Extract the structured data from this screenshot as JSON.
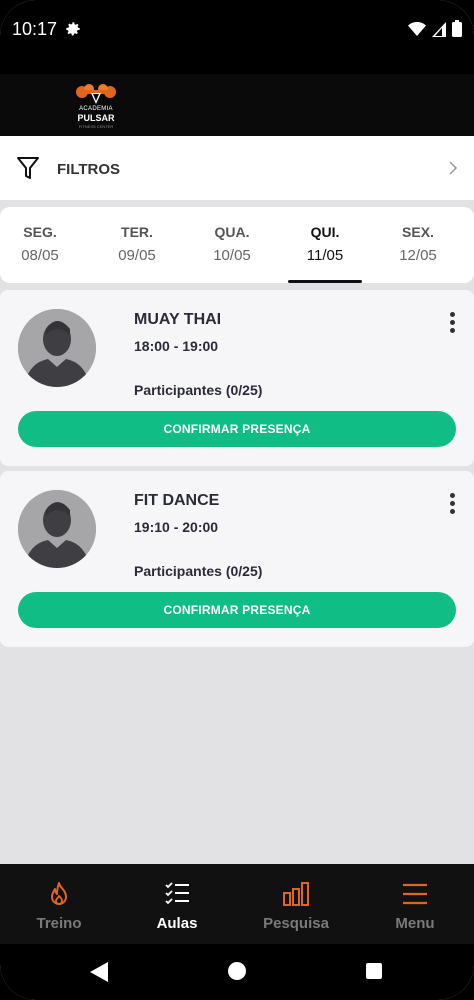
{
  "status_bar": {
    "time": "10:17",
    "icons": [
      "gear-icon",
      "wifi-icon",
      "signal-icon",
      "battery-icon"
    ]
  },
  "header": {
    "logo_line1": "ACADEMIA",
    "logo_line2": "PULSAR",
    "logo_line3": "FITNESS CENTER"
  },
  "filters": {
    "label": "FILTROS",
    "icon": "filter-icon"
  },
  "days": [
    {
      "name": "SEG.",
      "date": "08/05"
    },
    {
      "name": "TER.",
      "date": "09/05"
    },
    {
      "name": "QUA.",
      "date": "10/05"
    },
    {
      "name": "QUI.",
      "date": "11/05",
      "active": true
    },
    {
      "name": "SEX.",
      "date": "12/05"
    }
  ],
  "classes": [
    {
      "title": "MUAY THAI",
      "time": "18:00 - 19:00",
      "participants": "Participantes (0/25)",
      "button": "CONFIRMAR PRESENÇA"
    },
    {
      "title": "FIT DANCE",
      "time": "19:10 - 20:00",
      "participants": "Participantes (0/25)",
      "button": "CONFIRMAR PRESENÇA"
    }
  ],
  "bottom_nav": [
    {
      "label": "Treino",
      "icon": "flame-icon"
    },
    {
      "label": "Aulas",
      "icon": "checklist-icon",
      "active": true
    },
    {
      "label": "Pesquisa",
      "icon": "bar-chart-icon"
    },
    {
      "label": "Menu",
      "icon": "hamburger-icon"
    }
  ],
  "colors": {
    "accent": "#e2651e",
    "confirm": "#0fbd85",
    "background": "#e2e1e4"
  }
}
